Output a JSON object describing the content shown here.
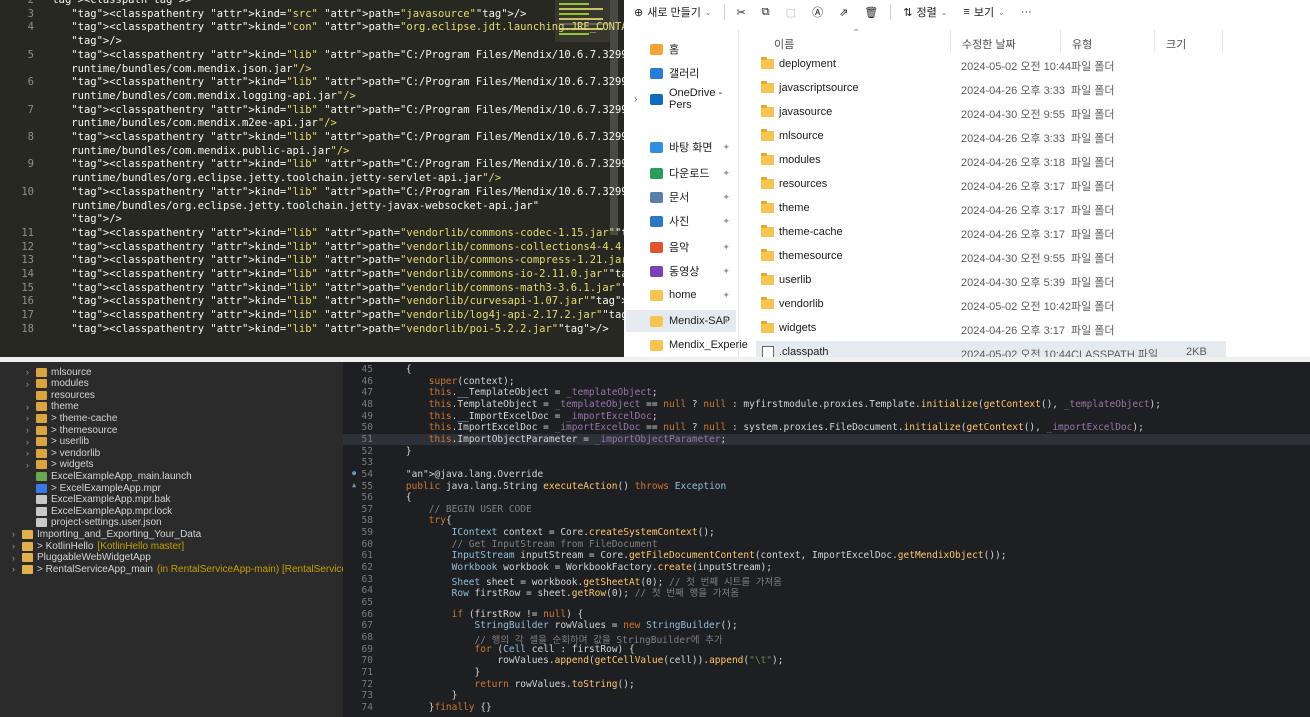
{
  "xml_editor": {
    "lines": [
      {
        "num": "2",
        "text": "<classpath>"
      },
      {
        "num": "3",
        "text": "    <classpathentry kind=\"src\" path=\"javasource\"/>"
      },
      {
        "num": "4",
        "text": "    <classpathentry kind=\"con\" path=\"org.eclipse.jdt.launching.JRE_CONTAINER\""
      },
      {
        "num": "",
        "text": "    />"
      },
      {
        "num": "5",
        "text": "    <classpathentry kind=\"lib\" path=\"C:/Program Files/Mendix/10.6.7.32997/"
      },
      {
        "num": "",
        "text": "    runtime/bundles/com.mendix.json.jar\"/>"
      },
      {
        "num": "6",
        "text": "    <classpathentry kind=\"lib\" path=\"C:/Program Files/Mendix/10.6.7.32997/"
      },
      {
        "num": "",
        "text": "    runtime/bundles/com.mendix.logging-api.jar\"/>"
      },
      {
        "num": "7",
        "text": "    <classpathentry kind=\"lib\" path=\"C:/Program Files/Mendix/10.6.7.32997/"
      },
      {
        "num": "",
        "text": "    runtime/bundles/com.mendix.m2ee-api.jar\"/>"
      },
      {
        "num": "8",
        "text": "    <classpathentry kind=\"lib\" path=\"C:/Program Files/Mendix/10.6.7.32997/"
      },
      {
        "num": "",
        "text": "    runtime/bundles/com.mendix.public-api.jar\"/>"
      },
      {
        "num": "9",
        "text": "    <classpathentry kind=\"lib\" path=\"C:/Program Files/Mendix/10.6.7.32997/"
      },
      {
        "num": "",
        "text": "    runtime/bundles/org.eclipse.jetty.toolchain.jetty-servlet-api.jar\"/>"
      },
      {
        "num": "10",
        "text": "    <classpathentry kind=\"lib\" path=\"C:/Program Files/Mendix/10.6.7.32997/"
      },
      {
        "num": "",
        "text": "    runtime/bundles/org.eclipse.jetty.toolchain.jetty-javax-websocket-api.jar\""
      },
      {
        "num": "",
        "text": "    />"
      },
      {
        "num": "11",
        "text": "    <classpathentry kind=\"lib\" path=\"vendorlib/commons-codec-1.15.jar\"/>"
      },
      {
        "num": "12",
        "text": "    <classpathentry kind=\"lib\" path=\"vendorlib/commons-collections4-4.4.jar\"/>"
      },
      {
        "num": "13",
        "text": "    <classpathentry kind=\"lib\" path=\"vendorlib/commons-compress-1.21.jar\"/>"
      },
      {
        "num": "14",
        "text": "    <classpathentry kind=\"lib\" path=\"vendorlib/commons-io-2.11.0.jar\"/>"
      },
      {
        "num": "15",
        "text": "    <classpathentry kind=\"lib\" path=\"vendorlib/commons-math3-3.6.1.jar\"/>"
      },
      {
        "num": "16",
        "text": "    <classpathentry kind=\"lib\" path=\"vendorlib/curvesapi-1.07.jar\"/>"
      },
      {
        "num": "17",
        "text": "    <classpathentry kind=\"lib\" path=\"vendorlib/log4j-api-2.17.2.jar\"/>"
      },
      {
        "num": "18",
        "text": "    <classpathentry kind=\"lib\" path=\"vendorlib/poi-5.2.2.jar\"/>"
      }
    ]
  },
  "explorer": {
    "toolbar": {
      "new_label": "새로 만들기",
      "sort_label": "정렬",
      "view_label": "보기",
      "more_label": "···"
    },
    "columns": {
      "name": "이름",
      "date": "수정한 날짜",
      "type": "유형",
      "size": "크기"
    },
    "nav": [
      {
        "label": "홈",
        "color": "#f4a33a",
        "pinned": false
      },
      {
        "label": "갤러리",
        "color": "#2a7bd6",
        "pinned": false
      },
      {
        "label": "OneDrive - Pers",
        "color": "#0f6cbd",
        "pinned": false,
        "chevron": true
      },
      {
        "label": "바탕 화면",
        "color": "#2f8fdf",
        "pinned": true
      },
      {
        "label": "다운로드",
        "color": "#2a9d5c",
        "pinned": true
      },
      {
        "label": "문서",
        "color": "#5a7ea8",
        "pinned": true
      },
      {
        "label": "사진",
        "color": "#2b79c2",
        "pinned": true
      },
      {
        "label": "음악",
        "color": "#e0542f",
        "pinned": true
      },
      {
        "label": "동영상",
        "color": "#7b3fb6",
        "pinned": true
      },
      {
        "label": "home",
        "color": "#f5c451",
        "pinned": true
      },
      {
        "label": "Mendix-SAP",
        "color": "#f5c451",
        "pinned": true,
        "selected": true
      },
      {
        "label": "Mendix_Experie",
        "color": "#f5c451",
        "pinned": false
      }
    ],
    "files": [
      {
        "name": "deployment",
        "date": "2024-05-02 오전 10:44",
        "type": "파일 폴더",
        "size": ""
      },
      {
        "name": "javascriptsource",
        "date": "2024-04-26 오후 3:33",
        "type": "파일 폴더",
        "size": ""
      },
      {
        "name": "javasource",
        "date": "2024-04-30 오전 9:55",
        "type": "파일 폴더",
        "size": ""
      },
      {
        "name": "mlsource",
        "date": "2024-04-26 오후 3:33",
        "type": "파일 폴더",
        "size": ""
      },
      {
        "name": "modules",
        "date": "2024-04-26 오후 3:18",
        "type": "파일 폴더",
        "size": ""
      },
      {
        "name": "resources",
        "date": "2024-04-26 오후 3:17",
        "type": "파일 폴더",
        "size": ""
      },
      {
        "name": "theme",
        "date": "2024-04-26 오후 3:17",
        "type": "파일 폴더",
        "size": ""
      },
      {
        "name": "theme-cache",
        "date": "2024-04-26 오후 3:17",
        "type": "파일 폴더",
        "size": ""
      },
      {
        "name": "themesource",
        "date": "2024-04-30 오전 9:55",
        "type": "파일 폴더",
        "size": ""
      },
      {
        "name": "userlib",
        "date": "2024-04-30 오후 5:39",
        "type": "파일 폴더",
        "size": ""
      },
      {
        "name": "vendorlib",
        "date": "2024-05-02 오전 10:42",
        "type": "파일 폴더",
        "size": ""
      },
      {
        "name": "widgets",
        "date": "2024-04-26 오후 3:17",
        "type": "파일 폴더",
        "size": ""
      },
      {
        "name": ".classpath",
        "date": "2024-05-02 오전 10:44",
        "type": "CLASSPATH 파일",
        "size": "2KB"
      }
    ]
  },
  "tree": {
    "items": [
      {
        "indent": 1,
        "twisty": "›",
        "label": "mlsource",
        "color": "#d9a441",
        "deco": ""
      },
      {
        "indent": 1,
        "twisty": "›",
        "label": "modules",
        "color": "#d9a441",
        "deco": ""
      },
      {
        "indent": 1,
        "twisty": "",
        "label": "resources",
        "color": "#d9a441",
        "deco": ""
      },
      {
        "indent": 1,
        "twisty": "›",
        "label": "theme",
        "color": "#d9a441",
        "deco": ""
      },
      {
        "indent": 1,
        "twisty": "›",
        "label": "> theme-cache",
        "color": "#d9a441",
        "deco": ""
      },
      {
        "indent": 1,
        "twisty": "›",
        "label": "> themesource",
        "color": "#d9a441",
        "deco": ""
      },
      {
        "indent": 1,
        "twisty": "›",
        "label": "> userlib",
        "color": "#d9a441",
        "deco": ""
      },
      {
        "indent": 1,
        "twisty": "›",
        "label": "> vendorlib",
        "color": "#d9a441",
        "deco": ""
      },
      {
        "indent": 1,
        "twisty": "›",
        "label": "> widgets",
        "color": "#d9a441",
        "deco": ""
      },
      {
        "indent": 1,
        "twisty": "",
        "label": "ExcelExampleApp_main.launch",
        "color": "#6aa84f",
        "deco": ""
      },
      {
        "indent": 1,
        "twisty": "",
        "label": "> ExcelExampleApp.mpr",
        "color": "#3b78e7",
        "deco": ""
      },
      {
        "indent": 1,
        "twisty": "",
        "label": "ExcelExampleApp.mpr.bak",
        "color": "#c8c8c8",
        "deco": ""
      },
      {
        "indent": 1,
        "twisty": "",
        "label": "ExcelExampleApp.mpr.lock",
        "color": "#c8c8c8",
        "deco": ""
      },
      {
        "indent": 1,
        "twisty": "",
        "label": "project-settings.user.json",
        "color": "#c8c8c8",
        "deco": ""
      },
      {
        "indent": 0,
        "twisty": "›",
        "label": "Importing_and_Exporting_Your_Data",
        "color": "#e0b050",
        "deco": ""
      },
      {
        "indent": 0,
        "twisty": "›",
        "label": "> KotlinHello",
        "color": "#e0b050",
        "deco": "[KotlinHello master]"
      },
      {
        "indent": 0,
        "twisty": "›",
        "label": "PluggableWebWidgetApp",
        "color": "#e0b050",
        "deco": ""
      },
      {
        "indent": 0,
        "twisty": "›",
        "label": "> RentalServiceApp_main",
        "color": "#e0b050",
        "deco": "(in RentalServiceApp-main) [RentalServiceApp-"
      }
    ]
  },
  "java_editor": {
    "lines": [
      {
        "num": "45",
        "code": "    {"
      },
      {
        "num": "46",
        "code": "        super(context);"
      },
      {
        "num": "47",
        "code": "        this.__TemplateObject = _templateObject;"
      },
      {
        "num": "48",
        "code": "        this.TemplateObject = _templateObject == null ? null : myfirstmodule.proxies.Template.initialize(getContext(), _templateObject);"
      },
      {
        "num": "49",
        "code": "        this.__ImportExcelDoc = _importExcelDoc;"
      },
      {
        "num": "50",
        "code": "        this.ImportExcelDoc = _importExcelDoc == null ? null : system.proxies.FileDocument.initialize(getContext(), _importExcelDoc);"
      },
      {
        "num": "51",
        "code": "        this.ImportObjectParameter = _importObjectParameter;"
      },
      {
        "num": "52",
        "code": "    }"
      },
      {
        "num": "53",
        "code": ""
      },
      {
        "num": "54",
        "code": "    @java.lang.Override"
      },
      {
        "num": "55",
        "code": "    public java.lang.String executeAction() throws Exception"
      },
      {
        "num": "56",
        "code": "    {"
      },
      {
        "num": "57",
        "code": "        // BEGIN USER CODE"
      },
      {
        "num": "58",
        "code": "        try{"
      },
      {
        "num": "59",
        "code": "            IContext context = Core.createSystemContext();"
      },
      {
        "num": "60",
        "code": "            // Get InputStream from FileDocument"
      },
      {
        "num": "61",
        "code": "            InputStream inputStream = Core.getFileDocumentContent(context, ImportExcelDoc.getMendixObject());"
      },
      {
        "num": "62",
        "code": "            Workbook workbook = WorkbookFactory.create(inputStream);"
      },
      {
        "num": "63",
        "code": "            Sheet sheet = workbook.getSheetAt(0); // 첫 번째 시트를 가져옴"
      },
      {
        "num": "64",
        "code": "            Row firstRow = sheet.getRow(0); // 첫 번째 행을 가져옴"
      },
      {
        "num": "65",
        "code": ""
      },
      {
        "num": "66",
        "code": "            if (firstRow != null) {"
      },
      {
        "num": "67",
        "code": "                StringBuilder rowValues = new StringBuilder();"
      },
      {
        "num": "68",
        "code": "                // 행의 각 셀을 순회하며 값을 StringBuilder에 추가"
      },
      {
        "num": "69",
        "code": "                for (Cell cell : firstRow) {"
      },
      {
        "num": "70",
        "code": "                    rowValues.append(getCellValue(cell)).append(\"\\t\");"
      },
      {
        "num": "71",
        "code": "                }"
      },
      {
        "num": "72",
        "code": "                return rowValues.toString();"
      },
      {
        "num": "73",
        "code": "            }"
      },
      {
        "num": "74",
        "code": "        }finally {}"
      }
    ]
  }
}
